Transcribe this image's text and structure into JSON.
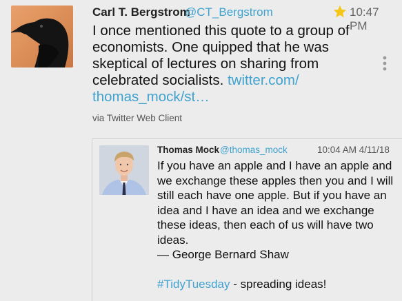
{
  "tweet": {
    "author_name": "Carl T. Bergstrom",
    "author_handle": "@CT_Bergstrom",
    "time": "10:47 PM",
    "text": "I once mentioned this quote to a group of economists. One quipped that he was skeptical of lectures on sharing from celebrated socialists. ",
    "link": "twitter.com/​thomas_mock/st…",
    "via": "via Twitter Web Client",
    "starred_color": "#f5c518"
  },
  "quoted": {
    "author_name": "Thomas Mock",
    "author_handle": "@thomas_mock",
    "time": "10:04 AM 4/11/18",
    "text": "If you have an apple and I have an apple and we exchange these apples then you and I will still each have one apple. But if you have an idea and I have an idea and we exchange these ideas, then each of us will have two ideas.\n— George Bernard Shaw\n\n",
    "hashtag": "#TidyTuesday",
    "after_hashtag": " - spreading ideas!"
  },
  "icons": {
    "star": "star-icon",
    "more": "more-vertical-icon"
  },
  "colors": {
    "link": "#3fa2cf",
    "background": "#ececec"
  }
}
